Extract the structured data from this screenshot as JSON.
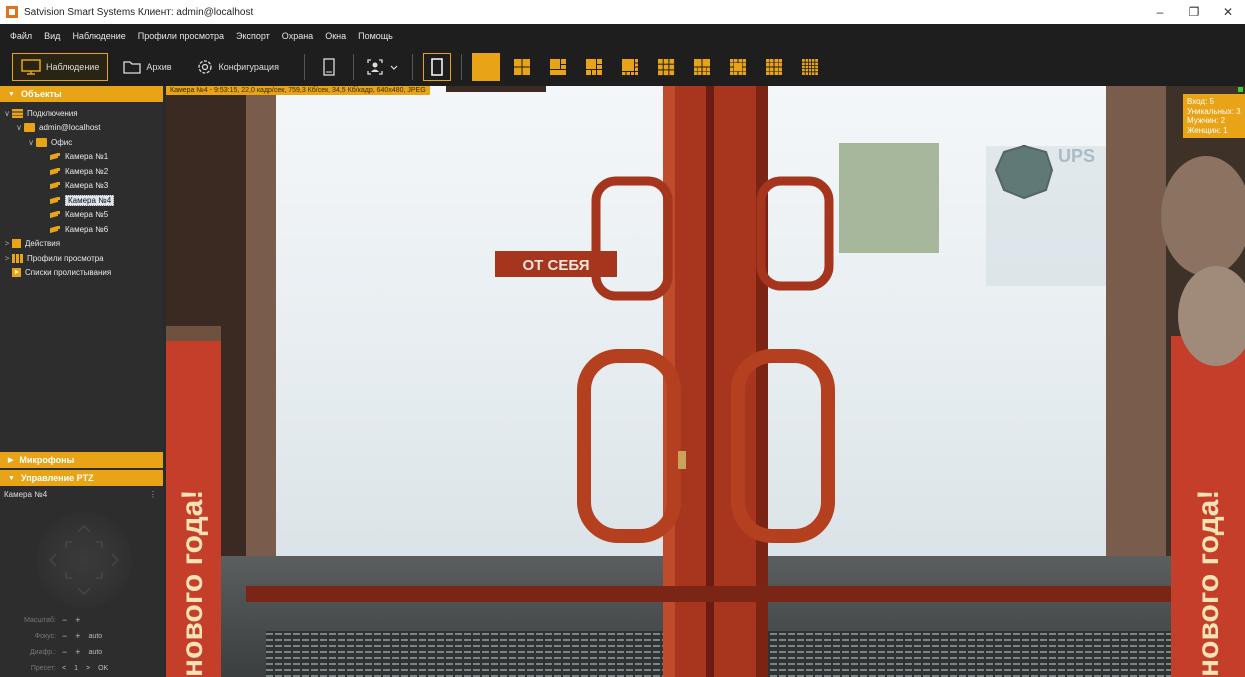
{
  "titlebar": {
    "title": "Satvision Smart Systems Клиент: admin@localhost",
    "controls": [
      "–",
      "❐",
      "✕"
    ]
  },
  "menu": [
    "Файл",
    "Вид",
    "Наблюдение",
    "Профили просмотра",
    "Экспорт",
    "Охрана",
    "Окна",
    "Помощь"
  ],
  "toolbar": {
    "modes": [
      {
        "label": "Наблюдение",
        "icon": "monitor-icon",
        "active": true
      },
      {
        "label": "Архив",
        "icon": "folder-icon",
        "active": false
      },
      {
        "label": "Конфигурация",
        "icon": "gear-icon",
        "active": false
      }
    ],
    "layout_count": 10
  },
  "left_panel": {
    "objects_header": "Объекты",
    "tree": [
      {
        "label": "Подключения",
        "icon": "connections-icon",
        "level": 0,
        "expander": "∨"
      },
      {
        "label": "admin@localhost",
        "icon": "server-icon",
        "level": 1,
        "expander": "∨"
      },
      {
        "label": "Офис",
        "icon": "folder-icon",
        "level": 2,
        "expander": "∨"
      },
      {
        "label": "Камера №1",
        "icon": "camera-icon",
        "level": 3,
        "expander": ""
      },
      {
        "label": "Камера №2",
        "icon": "camera-icon",
        "level": 3,
        "expander": ""
      },
      {
        "label": "Камера №3",
        "icon": "camera-icon",
        "level": 3,
        "expander": ""
      },
      {
        "label": "Камера №4",
        "icon": "camera-icon",
        "level": 3,
        "expander": "",
        "selected": true
      },
      {
        "label": "Камера №5",
        "icon": "camera-icon",
        "level": 3,
        "expander": ""
      },
      {
        "label": "Камера №6",
        "icon": "camera-icon",
        "level": 3,
        "expander": ""
      },
      {
        "label": "Действия",
        "icon": "actions-icon",
        "level": 0,
        "expander": ">"
      },
      {
        "label": "Профили просмотра",
        "icon": "grid-icon",
        "level": 0,
        "expander": ">"
      },
      {
        "label": "Списки пролистывания",
        "icon": "play-icon",
        "level": 0,
        "expander": ""
      }
    ],
    "microphones_header": "Микрофоны",
    "ptz_header": "Управление PTZ",
    "ptz": {
      "camera": "Камера №4",
      "menu": "⋮",
      "zoom_label": "Масштаб:",
      "focus_label": "Фокус:",
      "iris_label": "Диафр.:",
      "preset_label": "Пресет:",
      "minus": "−",
      "plus": "+",
      "auto": "auto",
      "prev": "<",
      "preset_value": "1",
      "next": ">",
      "ok": "OK"
    }
  },
  "video": {
    "osd": "Камера №4 - 9:53:15, 22,0 кадр/сек, 759,3 Кб/сек, 34,5 Кб/кадр, 640x480, JPEG",
    "stats": [
      "Вход: 5",
      "Уникальных: 3",
      "Мужчин: 2",
      "Женщин: 1"
    ],
    "door_sign": "ОТ СЕБЯ",
    "banner_left": "нового года!",
    "banner_right": "нового года!",
    "window_sign": "UPS"
  },
  "colors": {
    "accent": "#e8a317",
    "background": "#2d2d2d",
    "menubar": "#1e1e1e",
    "door_red": "#a8361f"
  }
}
